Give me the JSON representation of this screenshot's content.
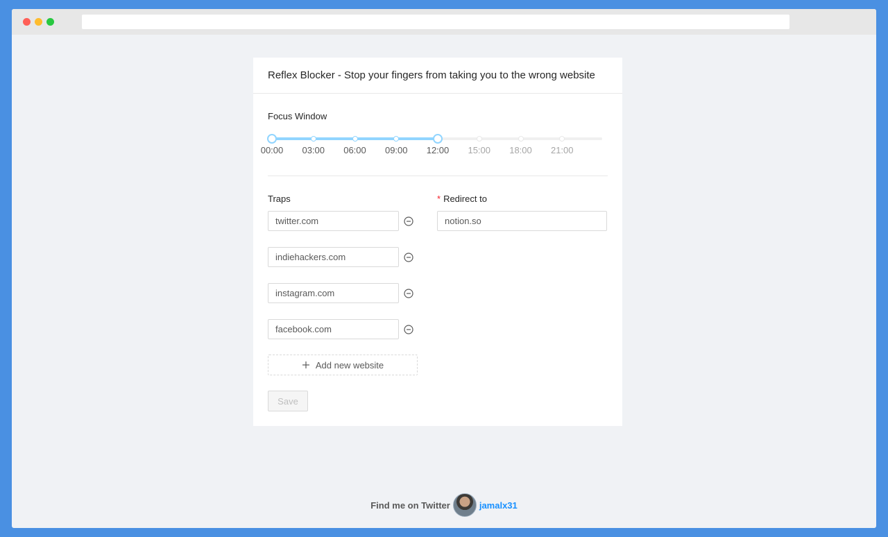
{
  "app": {
    "title": "Reflex Blocker - Stop your fingers from taking you to the wrong website"
  },
  "focus_window": {
    "label": "Focus Window",
    "marks": [
      "00:00",
      "03:00",
      "06:00",
      "09:00",
      "12:00",
      "15:00",
      "18:00",
      "21:00"
    ],
    "range_start": "00:00",
    "range_end": "12:00",
    "range_start_fraction": 0,
    "range_end_fraction": 0.5,
    "accent": "#91d5ff"
  },
  "traps": {
    "label": "Traps",
    "items": [
      "twitter.com",
      "indiehackers.com",
      "instagram.com",
      "facebook.com"
    ],
    "add_label": "Add new website"
  },
  "redirect": {
    "label": "Redirect to",
    "value": "notion.so"
  },
  "save_label": "Save",
  "footer": {
    "text": "Find me on Twitter",
    "handle": "jamalx31",
    "link_color": "#1890ff"
  }
}
